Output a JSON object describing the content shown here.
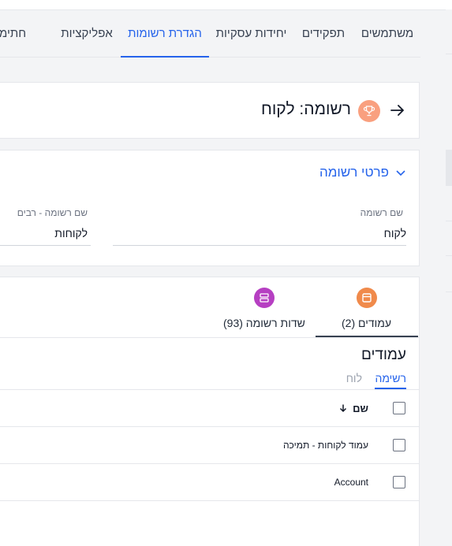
{
  "top_tabs": [
    {
      "label": "משתמשים",
      "active": false
    },
    {
      "label": "תפקידים",
      "active": false
    },
    {
      "label": "יחידות עסקיות",
      "active": false
    },
    {
      "label": "הגדרת רשומות",
      "active": true
    },
    {
      "label": "אפליקציות",
      "active": false
    },
    {
      "label": "חתימה אי",
      "active": false
    }
  ],
  "header": {
    "title": "רשומה: לקוח",
    "back_icon": "arrow-right-icon",
    "record_icon": "trophy-icon",
    "record_icon_color": "#f9a07f"
  },
  "details": {
    "section_title": "פרטי רשומה",
    "fields": [
      {
        "label": "שם רשומה",
        "value": "לקוח"
      },
      {
        "label": "שם רשומה - רבים",
        "value": "לקוחות"
      }
    ]
  },
  "column_tabs": [
    {
      "label": "עמודים (2)",
      "icon": "page-layout-icon",
      "icon_color": "#f08a4b",
      "active": true
    },
    {
      "label": "שדות רשומה (93)",
      "icon": "fields-icon",
      "icon_color": "#b63fc2",
      "active": false
    }
  ],
  "columns": {
    "heading": "עמודים",
    "views": [
      {
        "label": "רשימה",
        "active": true
      },
      {
        "label": "לוח",
        "active": false
      }
    ],
    "table": {
      "header": {
        "label": "שם",
        "sort_icon": "arrow-down-icon"
      },
      "rows": [
        "עמוד לקוחות - תמיכה",
        "Account"
      ]
    }
  },
  "accent_color": "#2563eb"
}
